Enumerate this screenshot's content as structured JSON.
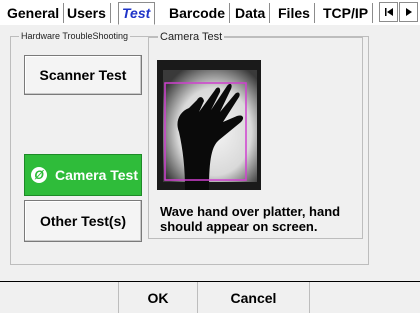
{
  "tabs": {
    "items": [
      "General",
      "Users",
      "Test",
      "Barcode",
      "Data",
      "Files",
      "TCP/IP"
    ],
    "active": "Test"
  },
  "panel": {
    "group_title": "Hardware TroubleShooting",
    "buttons": {
      "scanner_test": "Scanner Test",
      "camera_test": "Camera Test",
      "other_tests": "Other Test(s)"
    },
    "camera_group_title": "Camera Test",
    "hint": "Wave hand over platter, hand should appear on screen."
  },
  "footer": {
    "ok": "OK",
    "cancel": "Cancel"
  },
  "colors": {
    "active_tab_text": "#1f34c8",
    "selected_button": "#2fbc3a",
    "camera_box": "#d040d0"
  },
  "icons": {
    "selected_check": "check-circle-icon",
    "scroll_prev": "first-arrow-icon",
    "scroll_next": "next-arrow-icon"
  }
}
